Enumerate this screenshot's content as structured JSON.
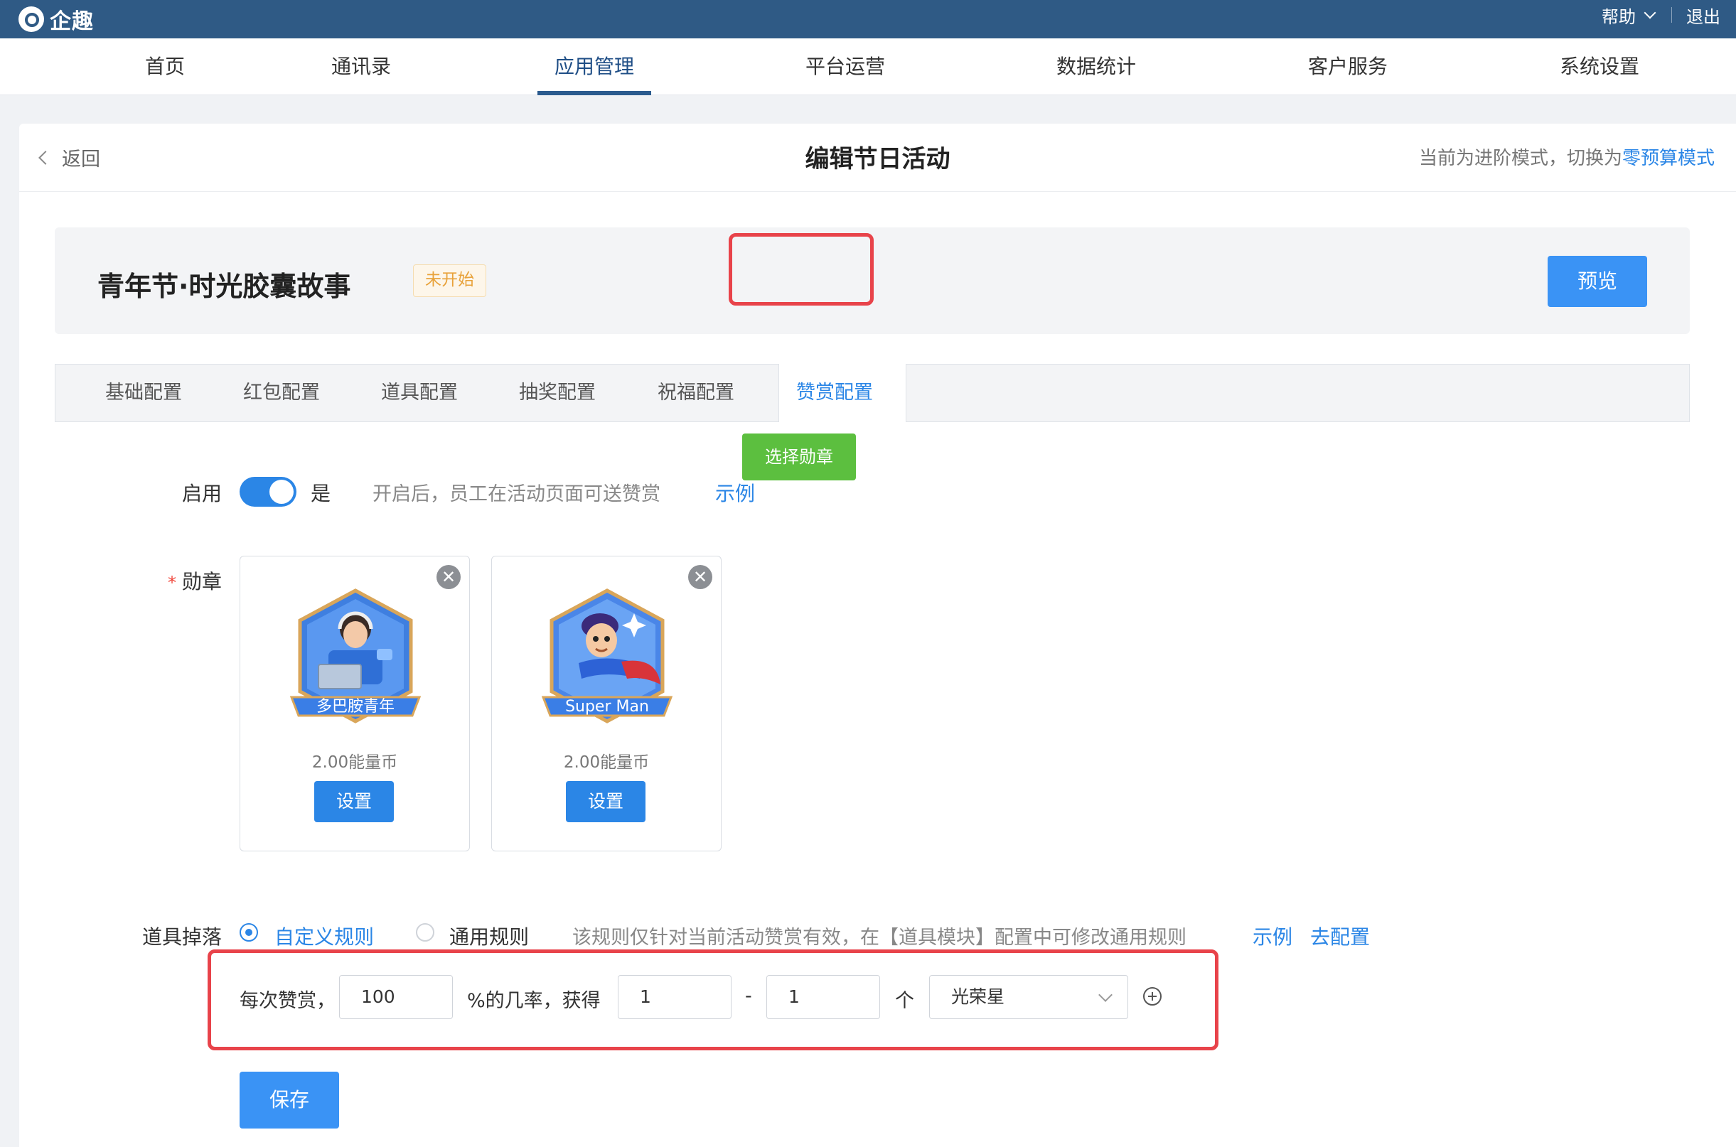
{
  "app": {
    "logo_text": "企趣",
    "help": "帮助",
    "logout": "退出"
  },
  "nav": {
    "items": [
      {
        "label": "首页"
      },
      {
        "label": "通讯录"
      },
      {
        "label": "应用管理"
      },
      {
        "label": "平台运营"
      },
      {
        "label": "数据统计"
      },
      {
        "label": "客户服务"
      },
      {
        "label": "系统设置"
      }
    ],
    "active_index": 2
  },
  "header": {
    "back": "返回",
    "title": "编辑节日活动",
    "mode_text": "当前为进阶模式，切换为",
    "mode_link": "零预算模式"
  },
  "activity": {
    "name": "青年节·时光胶囊故事",
    "status": "未开始",
    "preview": "预览"
  },
  "tabs": {
    "items": [
      {
        "label": "基础配置"
      },
      {
        "label": "红包配置"
      },
      {
        "label": "道具配置"
      },
      {
        "label": "抽奖配置"
      },
      {
        "label": "祝福配置"
      },
      {
        "label": "赞赏配置"
      }
    ],
    "active_index": 5
  },
  "enable": {
    "label": "启用",
    "on": true,
    "state_text": "是",
    "hint": "开启后，员工在活动页面可送赞赏",
    "example": "示例"
  },
  "medals": {
    "label": "勋章",
    "required_mark": "*",
    "items": [
      {
        "name": "多巴胺青年",
        "price": "2.00能量币",
        "set_label": "设置",
        "close": "✕"
      },
      {
        "name": "Super Man",
        "price": "2.00能量币",
        "set_label": "设置",
        "close": "✕"
      }
    ],
    "select_button": "选择勋章"
  },
  "drop": {
    "label": "道具掉落",
    "options": [
      {
        "label": "自定义规则",
        "selected": true
      },
      {
        "label": "通用规则",
        "selected": false
      }
    ],
    "hint": "该规则仅针对当前活动赞赏有效，在【道具模块】配置中可修改通用规则",
    "example": "示例",
    "configure": "去配置",
    "rule": {
      "prefix": "每次赞赏，",
      "probability": "100",
      "mid": "%的几率，获得",
      "min": "1",
      "dash": "-",
      "max": "1",
      "unit": "个",
      "item": "光荣星"
    }
  },
  "save": "保存",
  "colors": {
    "topbar": "#2f5a85",
    "primary": "#3a93f5",
    "link": "#2b86e6",
    "highlight": "#e8434a",
    "green": "#5cbf3f",
    "badge": "#e8a23a"
  }
}
